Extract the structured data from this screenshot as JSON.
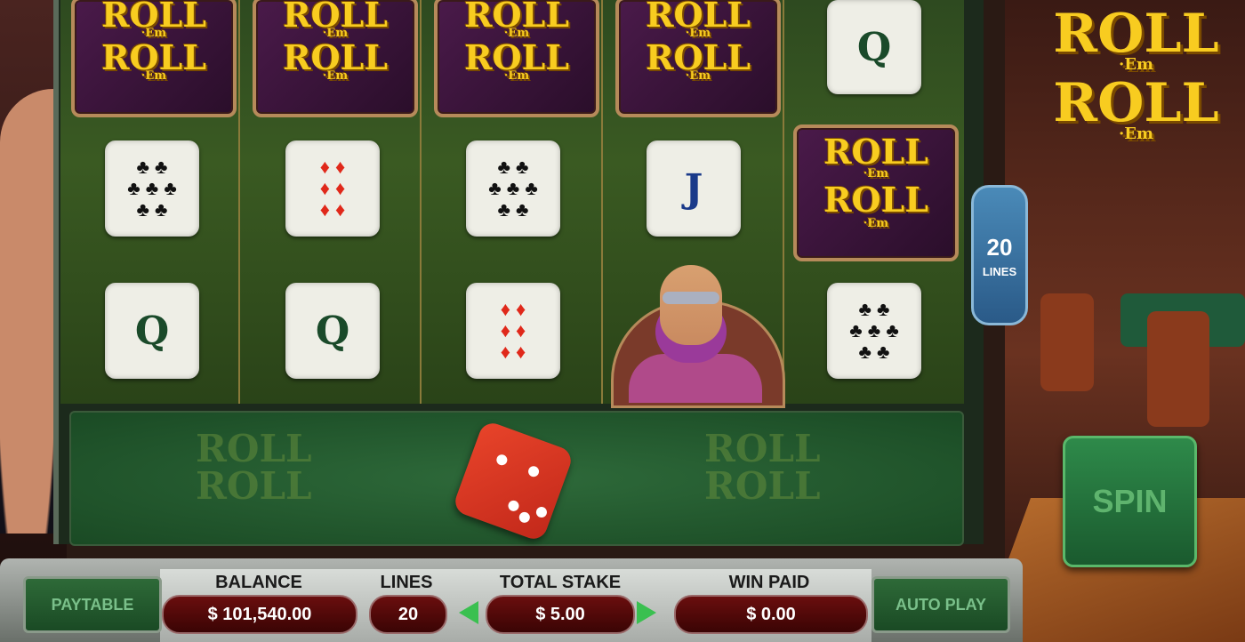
{
  "game": {
    "logo_word1": "ROLL",
    "logo_em": "·Em",
    "logo_word2": "ROLL"
  },
  "reels": [
    {
      "symbols": [
        "wild",
        "six-clubs",
        "queen"
      ]
    },
    {
      "symbols": [
        "wild",
        "six-diamonds",
        "queen"
      ]
    },
    {
      "symbols": [
        "wild",
        "six-clubs",
        "six-diamonds"
      ]
    },
    {
      "symbols": [
        "wild",
        "jack",
        "lady"
      ]
    },
    {
      "symbols": [
        "queen",
        "wild",
        "six-clubs"
      ]
    }
  ],
  "symbol_glyphs": {
    "six-clubs": "♣ ♣\n♣ ♣ ♣\n♣ ♣",
    "six-diamonds": "♦ ♦\n♦ ♦\n♦ ♦",
    "queen": "Q",
    "jack": "J"
  },
  "lines_badge": {
    "number": "20",
    "label": "LINES"
  },
  "buttons": {
    "paytable": "PAYTABLE",
    "auto_play": "AUTO PLAY",
    "spin": "SPIN"
  },
  "stats": {
    "balance_label": "BALANCE",
    "balance_value": "$ 101,540.00",
    "lines_label": "LINES",
    "lines_value": "20",
    "stake_label": "TOTAL STAKE",
    "stake_value": "$ 5.00",
    "win_label": "WIN PAID",
    "win_value": "$ 0.00"
  },
  "colors": {
    "suit_black": "#111111",
    "suit_red": "#e0281a",
    "logo_gold": "#f8cc20"
  }
}
